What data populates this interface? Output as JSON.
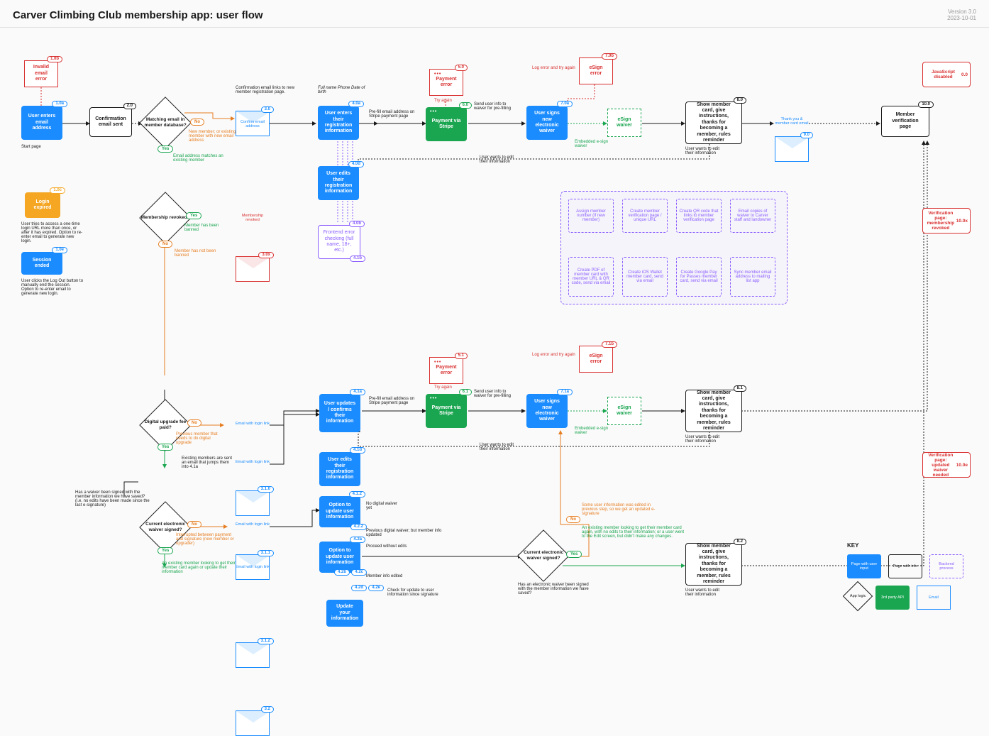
{
  "header": {
    "title": "Carver Climbing Club membership app: user flow",
    "version": "Version 3.0",
    "date": "2023-10-01"
  },
  "nodes": {
    "n1_0a": "User enters email address",
    "t1_0a": "1.0a",
    "n1_0b": "Invalid email error",
    "t1_0b": "1.0b",
    "n1_0c": "Login expired",
    "t1_0c": "1.0c",
    "n1_0e": "Session ended",
    "t1_0e": "1.0e",
    "n2_0": "Confirmation email sent",
    "t2_0": "2.0",
    "d1": "Matching email in member database?",
    "d2": "Membership revoked?",
    "n3_0": "Confirm email address",
    "t3_0": "3.0",
    "n3_0x": "Membership revoked",
    "t3_0x": "3.0x",
    "n4_0a": "User enters their registration information",
    "t4_0a": "4.0a",
    "n4_0b": "Frontend error checking (full name, 18+, etc.)",
    "t4_0b": "4.0b",
    "t4_1b": "4.1b",
    "n4_0d": "User edits their registration information",
    "t4_0d": "4.0d",
    "n5_0": "Payment error",
    "t5_0": "5.0",
    "n6_0": "Payment via Stripe",
    "t6_0": "6.0",
    "n7_0a": "User signs new electronic waiver",
    "t7_0a": "7.0a",
    "n7_0b": "eSign error",
    "t7_0b": "7.0b",
    "waiver1": "eSign waiver",
    "n8_0": "Show member card, give instructions, thanks for becoming a member, rules reminder",
    "t8_0": "8.0",
    "n9_0": "Thank you & member card email",
    "t9_0": "9.0",
    "n10_0": "Member verification page",
    "t10_0": "10.0",
    "n10_0x": "Verification page: membership revoked",
    "t10_0x": "10.0x",
    "n10_0a": "Verification page: updated waiver needed",
    "t10_0a": "10.0e",
    "n0_0": "JavaScript disabled",
    "t0_0": "0.0",
    "d3": "Digital upgrade fee paid?",
    "d4": "Has a waiver been signed with the member information we have saved? (i.e. no edits have been made since the last e-signature)",
    "d5": "Current electronic waiver signed?",
    "d6": "Current electronic waiver signed?",
    "n3_1_0": "Email with login link",
    "t3_1_0": "3.1.0",
    "n3_1_1": "Email with login link",
    "t3_1_1": "3.1.1",
    "n3_1_2": "Email with login link",
    "t3_1_2": "3.1.2",
    "n3_2": "Email with login link",
    "t3_2": "3.2",
    "n4_1a": "User updates / confirms their information",
    "t4_1a": "4.1a",
    "n4_1d": "User edits their registration information",
    "t4_1d": "4.1d",
    "n4_1_2": "Option to update user information",
    "t4_1_2": "4.1.2",
    "t4_2_2": "4.2.2",
    "n4_2a": "Option to update user information",
    "t4_2a": "4.2a",
    "t4_2b": "4.2b",
    "t4_2c": "4.2c",
    "t4_2d": "4.2d",
    "t4_2e": "4.2e",
    "n_update": "Update your information",
    "n5_1": "Payment error",
    "t5_1": "5.1",
    "n6_1": "Payment via Stripe",
    "t6_1": "6.1",
    "n7_1a": "User signs new electronic waiver",
    "t7_1a": "7.1a",
    "n7_1b": "eSign error",
    "t7_1b": "7.1b",
    "n8_1": "Show member card, give instructions, thanks for becoming a member, rules reminder",
    "t8_1": "8.1",
    "n8_2": "Show member card, give instructions, thanks for becoming a member, rules reminder",
    "t8_2": "8.2",
    "backend": {
      "b1": "Assign member number (if new member)",
      "b2": "Create member verification page / unique URL",
      "b3": "Create QR code that links to member verification page",
      "b4": "Email copies of waiver to Carver staff and landowner",
      "b5": "Create PDF of member card with member URL & QR code, send via email",
      "b6": "Create iOS Wallet member card, send via email",
      "b7": "Create Google Pay for Passes member card, send via email",
      "b8": "Sync member email address to mailing list app"
    }
  },
  "captions": {
    "start": "Start page",
    "c1_0c": "User tries to access a one-time login URL more than once, or after it has expired. Option to re-enter email to generate new login.",
    "c1_0e": "User clicks the Log Out button to manually end the session. Option to re-enter email to generate new login.",
    "c_confirm": "Confirmation email links to new member registration page.",
    "c_fullname": "Full name\nPhone\nDate of birth",
    "c_prefill": "Pre-fill email address on Stripe payment page",
    "c_newmember": "New member; or existing member with new email address",
    "c_match": "Email address matches an existing member",
    "c_banned": "Member has been banned",
    "c_notbanned": "Member has not been banned",
    "c_sendinfo": "Send user info to waiver for pre-filling",
    "c_logerror": "Log error and try again",
    "c_tryagain": "Try again",
    "c_embedded": "Embedded e-sign waiver",
    "c_editinfo": "User wants to edit their information",
    "c_prevmember": "Previous member that needs to do digital upgrade",
    "c_existing": "Existing members are sent an email that jumps them into 4.1a",
    "c_interrupt": "Interrupted between payment and signature (new member or upgrader)",
    "c_existing2": "An existing member looking to get their member card again or update their information",
    "c_nowaiver": "No digital waiver yet",
    "c_prevwaiver": "Previous digital waiver; but member info updated",
    "c_proceed": "Proceed without edits",
    "c_edited": "Member info edited",
    "c_check": "Check for update to user information since signature",
    "c_signed": "Has an electronic waiver been signed with the member information we have saved?",
    "c_someedit": "Some user information was edited in previous step, so we get an updated e-signature",
    "c_noexisting": "An existing member looking to get their member card again, with no edits to their information; or a user went to the Edit screen, but didn't make any changes."
  },
  "key": {
    "title": "KEY",
    "k1": "Page with user input",
    "k2": "Page with info",
    "k3": "Backend process",
    "k4": "App logic",
    "k5": "3rd party API",
    "k6": "Email"
  }
}
